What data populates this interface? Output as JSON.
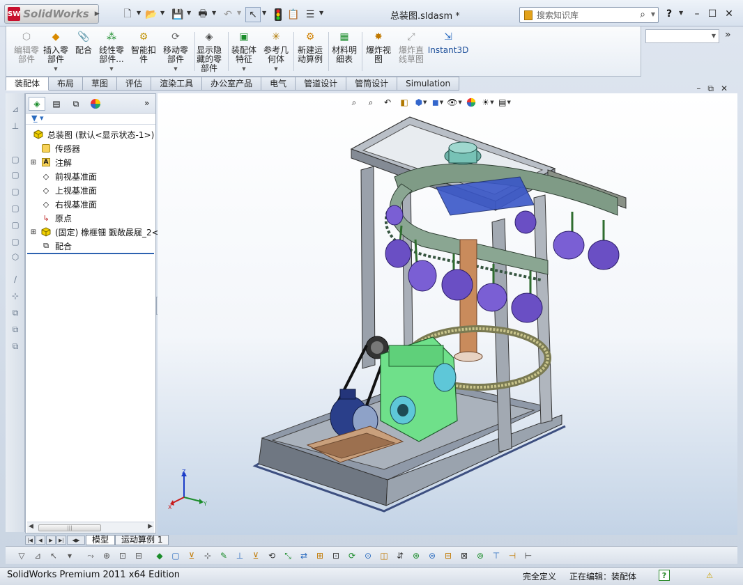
{
  "app": {
    "name": "SolidWorks",
    "logo_badge": "SW",
    "document_title": "总装图.sldasm *",
    "search_placeholder": "搜索知识库",
    "help_label": "?"
  },
  "quick_access": [
    "new-icon",
    "open-icon",
    "save-icon",
    "print-icon",
    "undo-icon",
    "select-icon",
    "rebuild-icon",
    "file-properties-icon",
    "options-icon"
  ],
  "command_manager": {
    "commands": [
      {
        "label": "编辑零\n部件",
        "icon": "edit-component-icon",
        "enabled": false
      },
      {
        "label": "插入零\n部件",
        "icon": "insert-component-icon",
        "enabled": true,
        "dropdown": true
      },
      {
        "label": "配合",
        "icon": "mate-icon",
        "enabled": true
      },
      {
        "label": "线性零\n部件...",
        "icon": "linear-pattern-icon",
        "enabled": true,
        "dropdown": true
      },
      {
        "label": "智能扣\n件",
        "icon": "smart-fastener-icon",
        "enabled": true
      },
      {
        "label": "移动零\n部件",
        "icon": "move-component-icon",
        "enabled": true,
        "dropdown": true
      },
      {
        "label": "显示隐\n藏的零\n部件",
        "icon": "show-hidden-icon",
        "enabled": true
      },
      {
        "label": "装配体\n特征",
        "icon": "assembly-features-icon",
        "enabled": true,
        "dropdown": true
      },
      {
        "label": "参考几\n何体",
        "icon": "reference-geometry-icon",
        "enabled": true,
        "dropdown": true
      },
      {
        "label": "新建运\n动算例",
        "icon": "new-motion-study-icon",
        "enabled": true
      },
      {
        "label": "材料明\n细表",
        "icon": "bom-icon",
        "enabled": true
      },
      {
        "label": "爆炸视\n图",
        "icon": "exploded-view-icon",
        "enabled": true
      },
      {
        "label": "爆炸直\n线草图",
        "icon": "explode-line-sketch-icon",
        "enabled": false
      },
      {
        "label": "Instant3D",
        "icon": "instant3d-icon",
        "enabled": true
      }
    ]
  },
  "tabs": [
    {
      "label": "装配体",
      "active": true
    },
    {
      "label": "布局",
      "active": false
    },
    {
      "label": "草图",
      "active": false
    },
    {
      "label": "评估",
      "active": false
    },
    {
      "label": "渲染工具",
      "active": false
    },
    {
      "label": "办公室产品",
      "active": false
    },
    {
      "label": "电气",
      "active": false
    },
    {
      "label": "管道设计",
      "active": false
    },
    {
      "label": "管筒设计",
      "active": false
    },
    {
      "label": "Simulation",
      "active": false
    }
  ],
  "feature_tree": {
    "root": "总装图  (默认<显示状态-1>)",
    "items": [
      {
        "label": "传感器",
        "icon": "sensor-icon",
        "expandable": false
      },
      {
        "label": "注解",
        "icon": "annotations-icon",
        "expandable": true
      },
      {
        "label": "前视基准面",
        "icon": "plane-icon",
        "expandable": false
      },
      {
        "label": "上视基准面",
        "icon": "plane-icon",
        "expandable": false
      },
      {
        "label": "右视基准面",
        "icon": "plane-icon",
        "expandable": false
      },
      {
        "label": "原点",
        "icon": "origin-icon",
        "expandable": false
      },
      {
        "label": "(固定) 橡榧钿 觐敞晸屣_2<",
        "icon": "part-icon",
        "expandable": true
      },
      {
        "label": "配合",
        "icon": "mates-folder-icon",
        "expandable": false
      }
    ]
  },
  "model_tabs": [
    {
      "label": "模型",
      "active": true
    },
    {
      "label": "运动算例 1",
      "active": false
    }
  ],
  "status": {
    "left": "SolidWorks Premium 2011 x64 Edition",
    "definition": "完全定义",
    "editing": "正在编辑：装配体"
  },
  "triad": {
    "x": "X",
    "y": "Y",
    "z": "Z"
  },
  "colors": {
    "accent": "#2d62b0",
    "frame": "#8e949c",
    "gear": "#6a4fc4",
    "gearbox": "#6fe08a",
    "motor": "#2a3f8a",
    "chain": "#7f9b86",
    "column": "#c88a5a"
  }
}
